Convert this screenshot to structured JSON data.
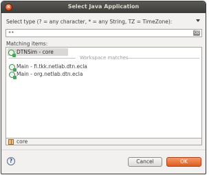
{
  "window": {
    "title": "Select Java Application"
  },
  "prompt": {
    "label": "Select type (? = any character, * = any String, TZ = TimeZone):"
  },
  "search": {
    "value": "**"
  },
  "matching": {
    "label": "Matching items:",
    "history_items": [
      {
        "label": "DTNSim - core",
        "selected": true
      }
    ],
    "separator_label": "Workspace matches",
    "workspace_items": [
      {
        "label": "Main - fi.tkk.netlab.dtn.ecla"
      },
      {
        "label": "Main - org.netlab.dtn.ecla"
      }
    ]
  },
  "status": {
    "text": "core"
  },
  "buttons": {
    "cancel": "Cancel",
    "ok": "OK"
  },
  "colors": {
    "titlebar": "#3d3c38",
    "accent": "#e05a1e",
    "background": "#f2f1f0"
  }
}
